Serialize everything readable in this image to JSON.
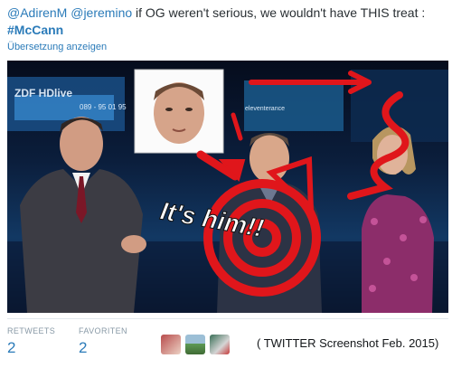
{
  "tweet": {
    "mention_1": "@AdirenM",
    "mention_2": "@jeremino",
    "text": " if OG weren't serious, we wouldn't have THIS treat :",
    "hashtag": "#McCann",
    "translate_link": "Übersetzung anzeigen"
  },
  "media": {
    "channel_logo": "ZDF HDlive",
    "overlay_text": "It's him!!",
    "studio_screen_left": "089 - 95 01 95",
    "studio_screen_right": "eleventerance"
  },
  "stats": {
    "retweets_label": "RETWEETS",
    "retweets_count": "2",
    "favorites_label": "FAVORITEN",
    "favorites_count": "2"
  },
  "avatars": [
    "avatar-user-1",
    "avatar-user-2",
    "avatar-user-3"
  ],
  "caption": "( TWITTER Screenshot Feb. 2015)",
  "colors": {
    "link": "#2b7bb9",
    "overlay_red": "#e0161b",
    "muted": "#8899a6"
  }
}
